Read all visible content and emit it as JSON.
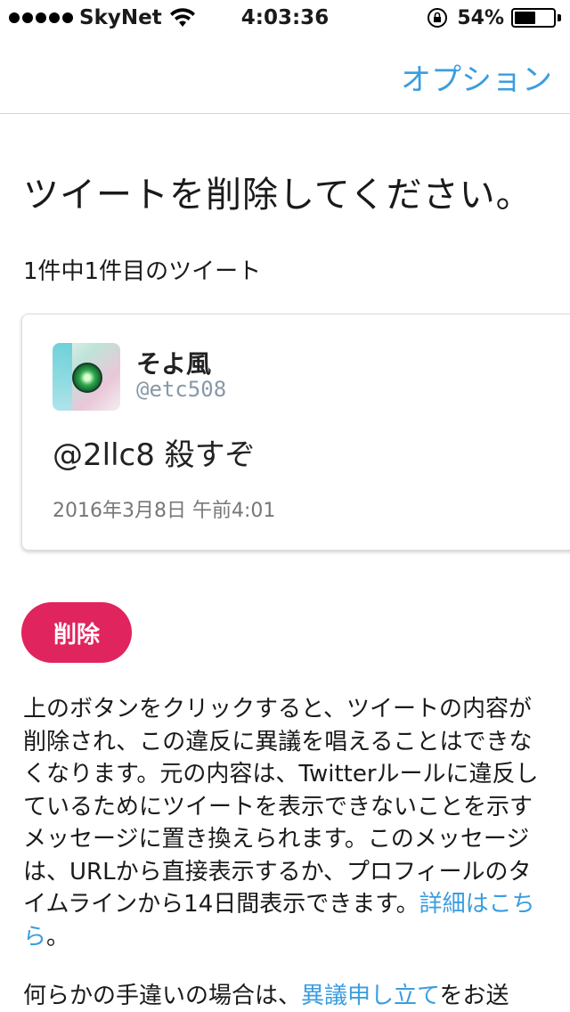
{
  "status_bar": {
    "carrier": "SkyNet",
    "time": "4:03:36",
    "battery_text": "54%",
    "battery_level": 0.54,
    "icons": [
      "signal-icon",
      "wifi-icon",
      "orientation-lock-icon",
      "battery-icon"
    ]
  },
  "nav": {
    "options_label": "オプション"
  },
  "page": {
    "title": "ツイートを削除してください。",
    "tweet_count": "1件中1件目のツイート"
  },
  "tweet": {
    "display_name": "そよ風",
    "handle": "@etc508",
    "text": "@2llc8 殺すぞ",
    "date": "2016年3月8日 午前4:01"
  },
  "actions": {
    "delete_label": "削除"
  },
  "explanation": {
    "body": "上のボタンをクリックすると、ツイートの内容が削除され、この違反に異議を唱えることはできなくなります。元の内容は、Twitterルールに違反しているためにツイートを表示できないことを示すメッセージに置き換えられます。このメッセージは、URLから直接表示するか、プロフィールのタイムラインから14日間表示できます。",
    "details_link": "詳細はこちら",
    "after_link": "。",
    "appeal_prefix": "何らかの手違いの場合は、",
    "appeal_link": "異議申し立て",
    "appeal_suffix": "をお送"
  },
  "colors": {
    "accent": "#3a9de0",
    "delete": "#e0245e"
  }
}
